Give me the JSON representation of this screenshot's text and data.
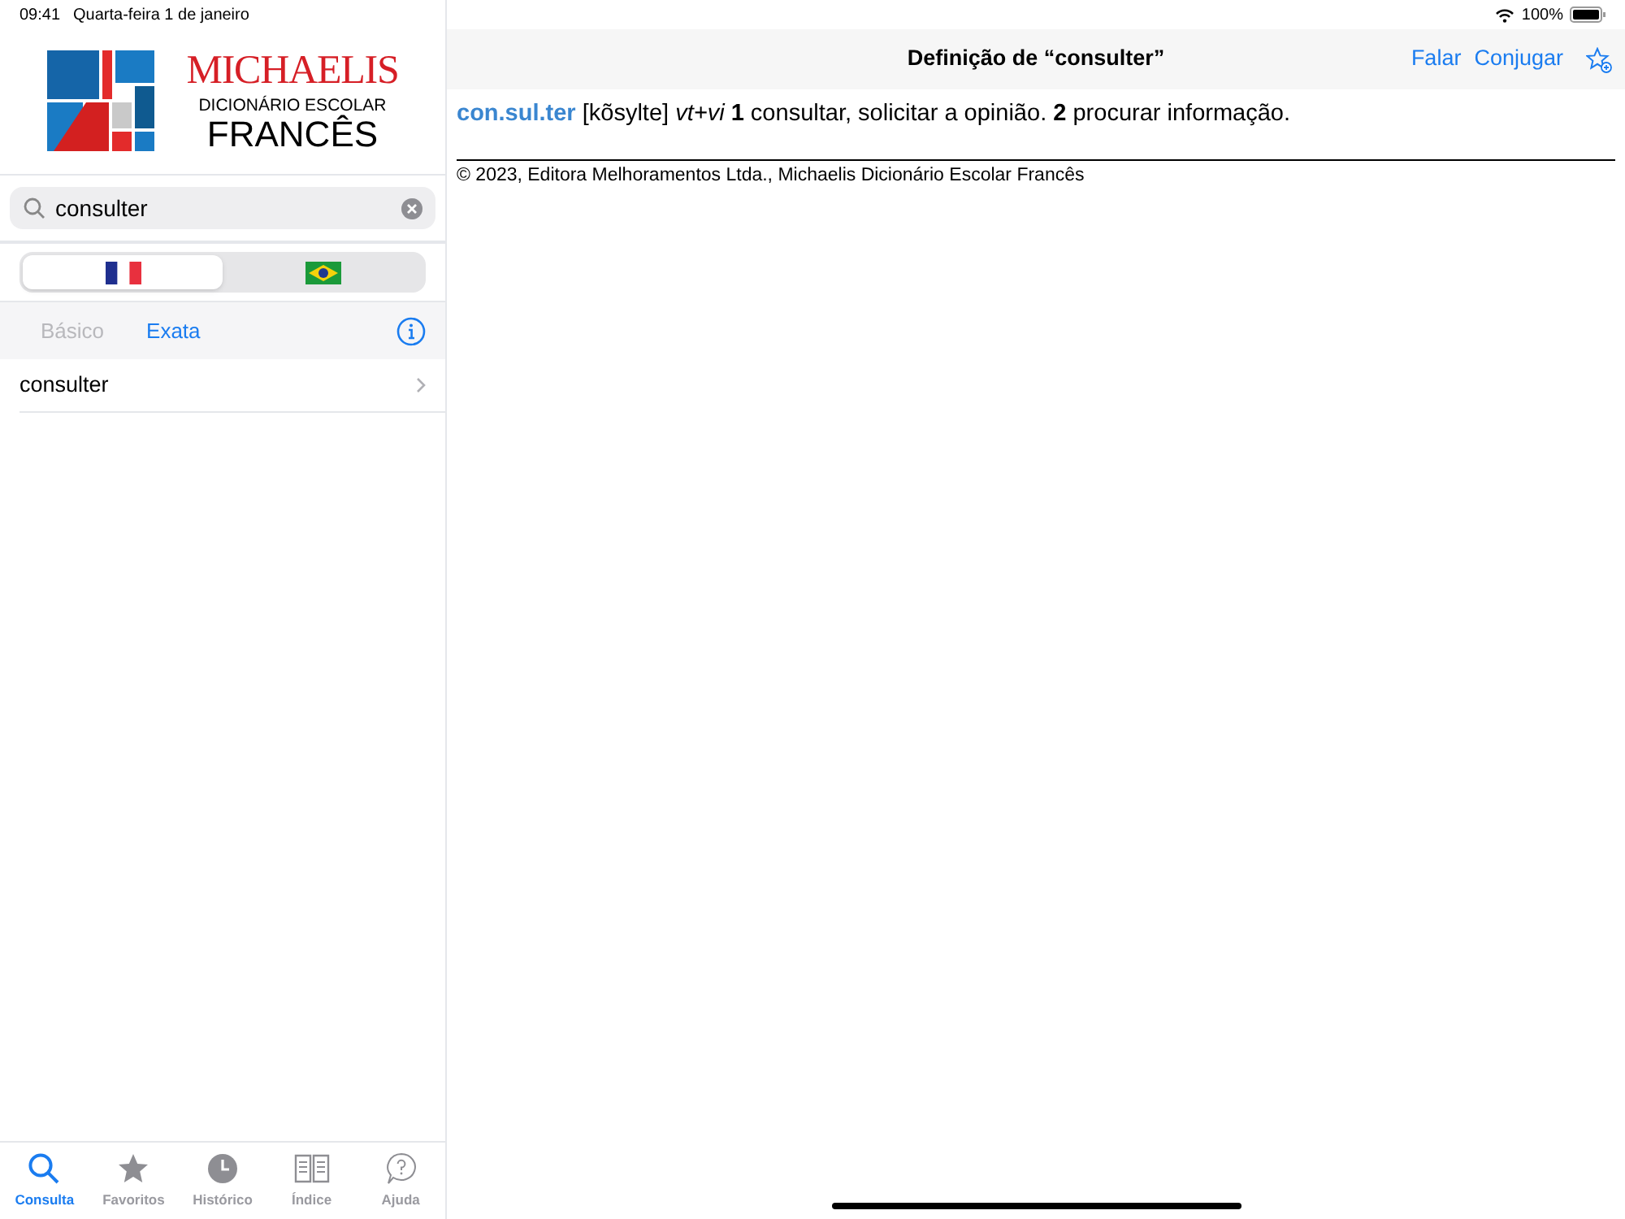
{
  "status_bar": {
    "time": "09:41",
    "date": "Quarta-feira 1 de janeiro",
    "battery": "100%"
  },
  "logo": {
    "brand": "MICHAELIS",
    "subtitle": "DICIONÁRIO ESCOLAR",
    "language": "FRANCÊS"
  },
  "search": {
    "value": "consulter"
  },
  "language_segments": [
    {
      "kind": "france",
      "selected": true
    },
    {
      "kind": "brazil",
      "selected": false
    }
  ],
  "mode_tabs": [
    {
      "label": "Básico",
      "selected": false
    },
    {
      "label": "Exata",
      "selected": true
    }
  ],
  "results": [
    {
      "label": "consulter"
    }
  ],
  "definition": {
    "title": "Definição de “consulter”",
    "actions": [
      "Falar",
      "Conjugar"
    ],
    "headword": "con.sul.ter",
    "body": "[kõsylte] *vt+vi* **1** consultar, solicitar a opinião. **2** procurar informação.",
    "copyright": "© 2023, Editora Melhoramentos Ltda., Michaelis Dicionário Escolar Francês"
  },
  "tab_bar": [
    {
      "kind": "search",
      "label": "Consulta",
      "selected": true
    },
    {
      "kind": "star",
      "label": "Favoritos",
      "selected": false
    },
    {
      "kind": "clock",
      "label": "Histórico",
      "selected": false
    },
    {
      "kind": "book",
      "label": "Índice",
      "selected": false
    },
    {
      "kind": "help",
      "label": "Ajuda",
      "selected": false
    }
  ]
}
